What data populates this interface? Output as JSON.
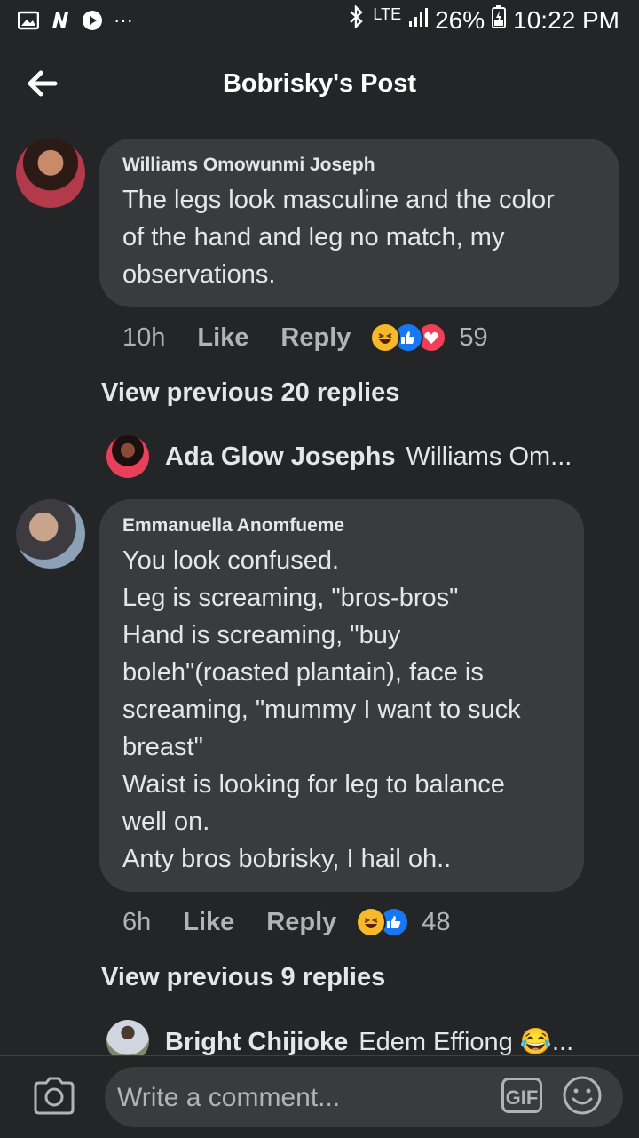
{
  "status_bar": {
    "network": "LTE",
    "battery": "26%",
    "time": "10:22 PM",
    "more": "···"
  },
  "header": {
    "title": "Bobrisky's Post"
  },
  "comments": [
    {
      "author": "Williams Omowunmi Joseph",
      "text": "The legs look masculine and the color\nof the hand and leg no match, my\nobservations.",
      "time": "10h",
      "like_label": "Like",
      "reply_label": "Reply",
      "reaction_count": "59",
      "reactions": [
        "haha",
        "like",
        "love"
      ],
      "view_previous": "View previous 20 replies",
      "latest_reply": {
        "author": "Ada Glow Josephs",
        "text": "Williams Om..."
      }
    },
    {
      "author": "Emmanuella Anomfueme",
      "text": "You look confused.\nLeg is screaming, \"bros-bros\"\nHand is screaming, \"buy\nboleh\"(roasted plantain), face is\nscreaming, \"mummy I want to suck\nbreast\"\nWaist is looking for leg to balance\nwell on.\nAnty bros bobrisky, I hail oh..",
      "time": "6h",
      "like_label": "Like",
      "reply_label": "Reply",
      "reaction_count": "48",
      "reactions": [
        "haha",
        "like"
      ],
      "view_previous": "View previous 9 replies",
      "latest_reply": {
        "author": "Bright Chijioke",
        "text": "Edem Effiong 😂..."
      }
    }
  ],
  "composer": {
    "placeholder": "Write a comment...",
    "gif_label": "GIF"
  },
  "colors": {
    "background": "#242526",
    "bubble": "#3a3b3c",
    "like_blue": "#1877f2",
    "love_red": "#f33e58",
    "haha_yellow": "#f7b928"
  }
}
